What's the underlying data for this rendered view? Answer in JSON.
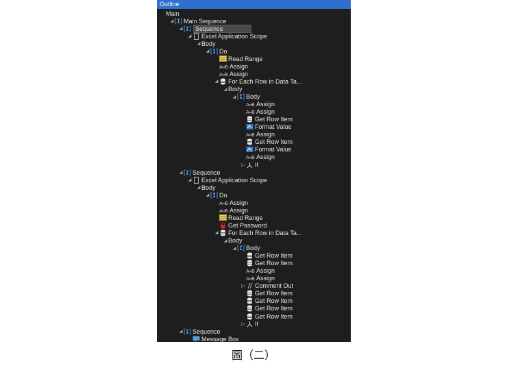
{
  "panel": {
    "title": "Outline"
  },
  "caption": "圖（二）",
  "colors": {
    "titlebar": "#2f6fd0",
    "background": "#1e1e1e",
    "text": "#e6e6e6",
    "selection": "#4a4a4a"
  },
  "tree": [
    {
      "label": "Main",
      "indent": 0,
      "arrow": "none",
      "icon": "none"
    },
    {
      "label": "Main Sequence",
      "indent": 1,
      "arrow": "down",
      "icon": "sequence"
    },
    {
      "label": "Sequence",
      "indent": 2,
      "arrow": "down",
      "icon": "sequence",
      "selected": true
    },
    {
      "label": "Excel Application Scope",
      "indent": 3,
      "arrow": "down",
      "icon": "page"
    },
    {
      "label": "Body",
      "indent": 4,
      "arrow": "down",
      "icon": "none"
    },
    {
      "label": "Do",
      "indent": 5,
      "arrow": "down",
      "icon": "sequence"
    },
    {
      "label": "Read Range",
      "indent": 6,
      "arrow": "none",
      "icon": "excel"
    },
    {
      "label": "Assign",
      "indent": 6,
      "arrow": "none",
      "icon": "assign"
    },
    {
      "label": "Assign",
      "indent": 6,
      "arrow": "none",
      "icon": "assign"
    },
    {
      "label": "For Each Row in Data Ta...",
      "indent": 6,
      "arrow": "down",
      "icon": "db"
    },
    {
      "label": "Body",
      "indent": 7,
      "arrow": "down",
      "icon": "none"
    },
    {
      "label": "Body",
      "indent": 8,
      "arrow": "down",
      "icon": "sequence"
    },
    {
      "label": "Assign",
      "indent": 9,
      "arrow": "none",
      "icon": "assign"
    },
    {
      "label": "Assign",
      "indent": 9,
      "arrow": "none",
      "icon": "assign"
    },
    {
      "label": "Get Row Item",
      "indent": 9,
      "arrow": "none",
      "icon": "db"
    },
    {
      "label": "Format Value",
      "indent": 9,
      "arrow": "none",
      "icon": "format"
    },
    {
      "label": "Assign",
      "indent": 9,
      "arrow": "none",
      "icon": "assign"
    },
    {
      "label": "Get Row Item",
      "indent": 9,
      "arrow": "none",
      "icon": "db"
    },
    {
      "label": "Format Value",
      "indent": 9,
      "arrow": "none",
      "icon": "format"
    },
    {
      "label": "Assign",
      "indent": 9,
      "arrow": "none",
      "icon": "assign"
    },
    {
      "label": "If",
      "indent": 9,
      "arrow": "right",
      "icon": "if"
    },
    {
      "label": "Sequence",
      "indent": 2,
      "arrow": "down",
      "icon": "sequence"
    },
    {
      "label": "Excel Application Scope",
      "indent": 3,
      "arrow": "down",
      "icon": "page"
    },
    {
      "label": "Body",
      "indent": 4,
      "arrow": "down",
      "icon": "none"
    },
    {
      "label": "Do",
      "indent": 5,
      "arrow": "down",
      "icon": "sequence"
    },
    {
      "label": "Assign",
      "indent": 6,
      "arrow": "none",
      "icon": "assign"
    },
    {
      "label": "Assign",
      "indent": 6,
      "arrow": "none",
      "icon": "assign"
    },
    {
      "label": "Read Range",
      "indent": 6,
      "arrow": "none",
      "icon": "excel"
    },
    {
      "label": "Get Password",
      "indent": 6,
      "arrow": "none",
      "icon": "lock"
    },
    {
      "label": "For Each Row in Data Ta...",
      "indent": 6,
      "arrow": "down",
      "icon": "db"
    },
    {
      "label": "Body",
      "indent": 7,
      "arrow": "down",
      "icon": "none"
    },
    {
      "label": "Body",
      "indent": 8,
      "arrow": "down",
      "icon": "sequence"
    },
    {
      "label": "Get Row Item",
      "indent": 9,
      "arrow": "none",
      "icon": "db"
    },
    {
      "label": "Get Row Item",
      "indent": 9,
      "arrow": "none",
      "icon": "db"
    },
    {
      "label": "Assign",
      "indent": 9,
      "arrow": "none",
      "icon": "assign"
    },
    {
      "label": "Assign",
      "indent": 9,
      "arrow": "none",
      "icon": "assign"
    },
    {
      "label": "Comment Out",
      "indent": 9,
      "arrow": "right",
      "icon": "comment"
    },
    {
      "label": "Get Row Item",
      "indent": 9,
      "arrow": "none",
      "icon": "db"
    },
    {
      "label": "Get Row Item",
      "indent": 9,
      "arrow": "none",
      "icon": "db"
    },
    {
      "label": "Get Row Item",
      "indent": 9,
      "arrow": "none",
      "icon": "db"
    },
    {
      "label": "Get Row Item",
      "indent": 9,
      "arrow": "none",
      "icon": "db"
    },
    {
      "label": "If",
      "indent": 9,
      "arrow": "right",
      "icon": "if"
    },
    {
      "label": "Sequence",
      "indent": 2,
      "arrow": "down",
      "icon": "sequence"
    },
    {
      "label": "Message Box",
      "indent": 3,
      "arrow": "none",
      "icon": "message"
    }
  ]
}
